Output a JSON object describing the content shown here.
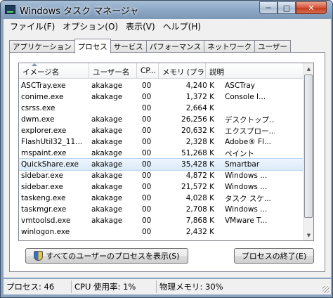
{
  "window": {
    "title": "Windows タスク マネージャ"
  },
  "menu": [
    "ファイル(F)",
    "オプション(O)",
    "表示(V)",
    "ヘルプ(H)"
  ],
  "tabs": [
    {
      "label": "アプリケーション",
      "active": false
    },
    {
      "label": "プロセス",
      "active": true
    },
    {
      "label": "サービス",
      "active": false
    },
    {
      "label": "パフォーマンス",
      "active": false
    },
    {
      "label": "ネットワーク",
      "active": false
    },
    {
      "label": "ユーザー",
      "active": false
    }
  ],
  "table": {
    "columns": [
      "イメージ名",
      "ユーザー名",
      "CP...",
      "メモリ (プラ...",
      "説明"
    ],
    "rows": [
      {
        "name": "ASCTray.exe",
        "user": "akakage",
        "cpu": "00",
        "mem": "4,240 K",
        "desc": "ASCTray"
      },
      {
        "name": "conime.exe",
        "user": "akakage",
        "cpu": "00",
        "mem": "1,372 K",
        "desc": "Console I..."
      },
      {
        "name": "csrss.exe",
        "user": "",
        "cpu": "00",
        "mem": "2,664 K",
        "desc": ""
      },
      {
        "name": "dwm.exe",
        "user": "akakage",
        "cpu": "00",
        "mem": "26,256 K",
        "desc": "デスクトップ..."
      },
      {
        "name": "explorer.exe",
        "user": "akakage",
        "cpu": "00",
        "mem": "20,632 K",
        "desc": "エクスプロー..."
      },
      {
        "name": "FlashUtil32_11...",
        "user": "akakage",
        "cpu": "00",
        "mem": "2,328 K",
        "desc": "Adobe® Fl..."
      },
      {
        "name": "mspaint.exe",
        "user": "akakage",
        "cpu": "00",
        "mem": "51,268 K",
        "desc": "ペイント"
      },
      {
        "name": "QuickShare.exe",
        "user": "akakage",
        "cpu": "00",
        "mem": "35,428 K",
        "desc": "Smartbar",
        "selected": true
      },
      {
        "name": "sidebar.exe",
        "user": "akakage",
        "cpu": "00",
        "mem": "4,872 K",
        "desc": "Windows ..."
      },
      {
        "name": "sidebar.exe",
        "user": "akakage",
        "cpu": "00",
        "mem": "21,572 K",
        "desc": "Windows ..."
      },
      {
        "name": "taskeng.exe",
        "user": "akakage",
        "cpu": "00",
        "mem": "4,028 K",
        "desc": "タスク スケ..."
      },
      {
        "name": "taskmgr.exe",
        "user": "akakage",
        "cpu": "00",
        "mem": "2,708 K",
        "desc": "Windows ..."
      },
      {
        "name": "vmtoolsd.exe",
        "user": "akakage",
        "cpu": "00",
        "mem": "7,868 K",
        "desc": "VMware T..."
      },
      {
        "name": "winlogon.exe",
        "user": "",
        "cpu": "00",
        "mem": "2,432 K",
        "desc": ""
      }
    ]
  },
  "buttons": {
    "show_all": "すべてのユーザーのプロセスを表示(S)",
    "end_process": "プロセスの終了(E)"
  },
  "status": {
    "processes": "プロセス: 46",
    "cpu": "CPU 使用率: 1%",
    "memory": "物理メモリ: 30%"
  }
}
